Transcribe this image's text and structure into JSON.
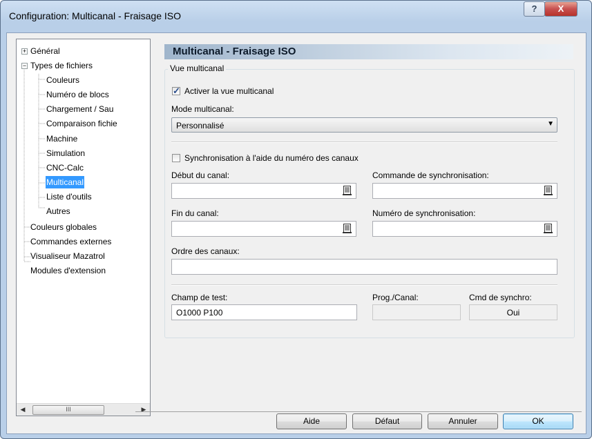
{
  "window": {
    "title": "Configuration: Multicanal - Fraisage ISO",
    "help_glyph": "?",
    "close_glyph": "X"
  },
  "tree": {
    "items": [
      {
        "label": "Général"
      },
      {
        "label": "Types de fichiers"
      },
      {
        "label": "Couleurs"
      },
      {
        "label": "Numéro de blocs"
      },
      {
        "label": "Chargement / Sau"
      },
      {
        "label": "Comparaison fichie"
      },
      {
        "label": "Machine"
      },
      {
        "label": "Simulation"
      },
      {
        "label": "CNC-Calc"
      },
      {
        "label": "Multicanal"
      },
      {
        "label": "Liste d'outils"
      },
      {
        "label": "Autres"
      },
      {
        "label": "Couleurs globales"
      },
      {
        "label": "Commandes externes"
      },
      {
        "label": "Visualiseur Mazatrol"
      },
      {
        "label": "Modules d'extension"
      }
    ],
    "selected": "Multicanal",
    "scroll_thumb": "III"
  },
  "panel": {
    "header": "Multicanal - Fraisage ISO",
    "group_title": "Vue multicanal",
    "activate_label": "Activer la vue multicanal",
    "activate_checked": true,
    "mode_label": "Mode multicanal:",
    "mode_value": "Personnalisé",
    "sync_label": "Synchronisation à l'aide du numéro des canaux",
    "sync_checked": false,
    "debut_label": "Début du canal:",
    "debut_value": "",
    "cmd_sync_label": "Commande de synchronisation:",
    "cmd_sync_value": "",
    "fin_label": "Fin du canal:",
    "fin_value": "",
    "num_sync_label": "Numéro de synchronisation:",
    "num_sync_value": "",
    "ordre_label": "Ordre des canaux:",
    "ordre_value": "",
    "test_label": "Champ de test:",
    "test_value": "O1000 P100",
    "prog_label": "Prog./Canal:",
    "prog_value": "",
    "cmd_synchro_label": "Cmd de synchro:",
    "cmd_synchro_value": "Oui"
  },
  "buttons": {
    "aide": "Aide",
    "defaut": "Défaut",
    "annuler": "Annuler",
    "ok": "OK"
  }
}
